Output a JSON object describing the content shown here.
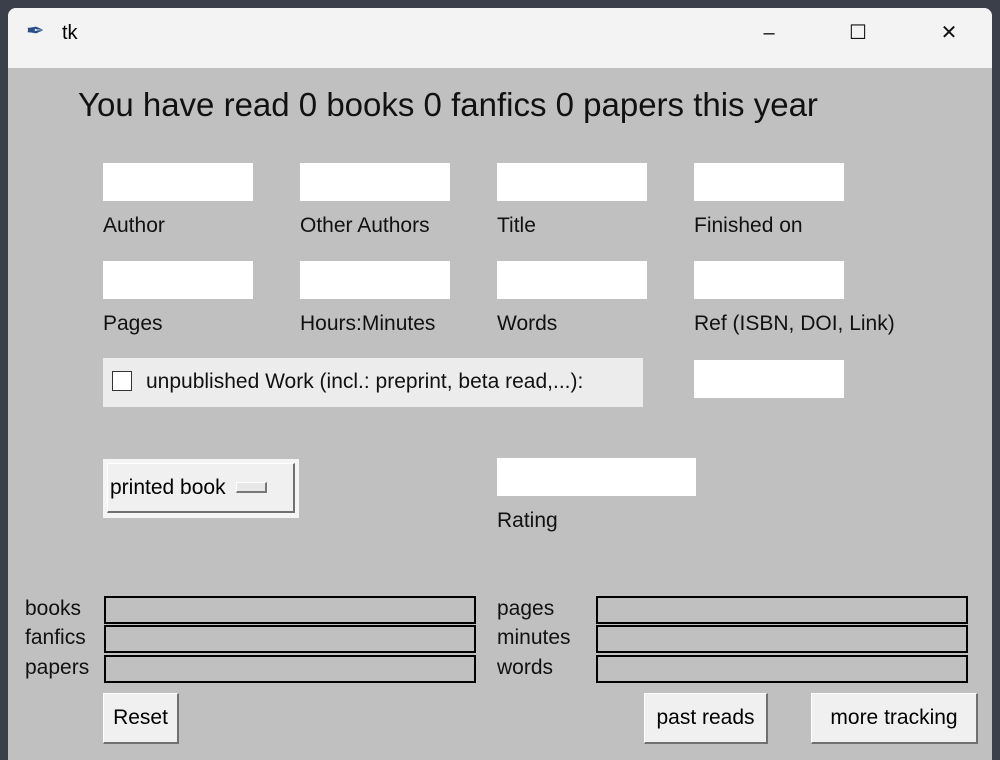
{
  "window": {
    "title": "tk",
    "minimize": "–",
    "maximize": "☐",
    "close": "✕"
  },
  "heading": "You have read 0 books 0 fanfics 0 papers this year",
  "fields": [
    {
      "label": "Author",
      "value": ""
    },
    {
      "label": "Other Authors",
      "value": ""
    },
    {
      "label": "Title",
      "value": ""
    },
    {
      "label": "Finished on",
      "value": ""
    },
    {
      "label": "Pages",
      "value": ""
    },
    {
      "label": "Hours:Minutes",
      "value": ""
    },
    {
      "label": "Words",
      "value": ""
    },
    {
      "label": "Ref (ISBN, DOI, Link)",
      "value": ""
    }
  ],
  "unpublished": {
    "label": "unpublished Work (incl.: preprint, beta read,...):",
    "checked": false,
    "value": ""
  },
  "type_menu": {
    "selected": "printed book"
  },
  "rating": {
    "label": "Rating",
    "value": ""
  },
  "stats_left": [
    {
      "label": "books",
      "value": ""
    },
    {
      "label": "fanfics",
      "value": ""
    },
    {
      "label": "papers",
      "value": ""
    }
  ],
  "stats_right": [
    {
      "label": "pages",
      "value": ""
    },
    {
      "label": "minutes",
      "value": ""
    },
    {
      "label": "words",
      "value": ""
    }
  ],
  "buttons": {
    "reset": "Reset",
    "past_reads": "past reads",
    "more_tracking": "more tracking"
  }
}
